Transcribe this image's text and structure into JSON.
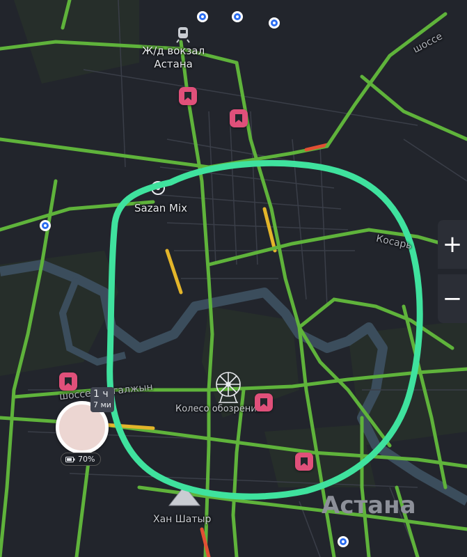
{
  "labels": {
    "station": "Ж/д вокзал\nАстана",
    "sazan": "Sazan Mix",
    "highway_top": "шоссе",
    "highway_right": "Косарь",
    "highway_left": "шоссе Коргалжын",
    "wheel": "Колесо обозрения",
    "city": "Астана",
    "khan": "Хан Шатыр"
  },
  "user": {
    "tooltip_line1": "1 ч",
    "tooltip_line2": "7 ми",
    "battery": "70%"
  },
  "zoom": {
    "plus": "+",
    "minus": "−"
  },
  "colors": {
    "background": "#22252c",
    "park": "#262e2a",
    "river": "#3b4d5c",
    "road_green": "#5fb33b",
    "road_yellow": "#e3b52a",
    "road_red": "#e25033",
    "annotation_circle": "#3fe29e",
    "bookmark": "#e0507a",
    "stop_blue": "#2a6cf0"
  },
  "icons": [
    "railway-icon",
    "bookmark-icon",
    "bus-stop-icon",
    "ferris-wheel-icon",
    "khan-shatyr-icon",
    "battery-icon"
  ]
}
